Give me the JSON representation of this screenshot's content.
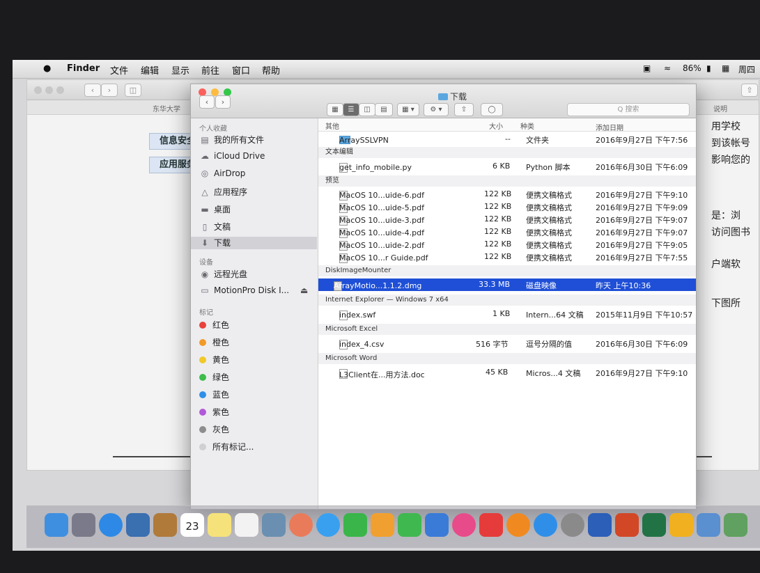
{
  "menubar": {
    "app": "Finder",
    "items": [
      "文件",
      "编辑",
      "显示",
      "前往",
      "窗口",
      "帮助"
    ],
    "battery": "86%",
    "clock": "周四"
  },
  "background_window": {
    "tab_label": "东华大学",
    "buttons": [
      "信息安全",
      "应用服务"
    ],
    "right_header": "说明",
    "right_texts": [
      "用学校",
      "到该帐号",
      "影响您的",
      "是：浏",
      "访问图书",
      "户端软",
      "下图所"
    ]
  },
  "finder": {
    "title": "下载",
    "search_placeholder": "Q 搜索",
    "sidebar": {
      "favorites_header": "个人收藏",
      "favorites": [
        {
          "icon": "all-files-icon",
          "label": "我的所有文件"
        },
        {
          "icon": "cloud-icon",
          "label": "iCloud Drive"
        },
        {
          "icon": "airdrop-icon",
          "label": "AirDrop"
        },
        {
          "icon": "applications-icon",
          "label": "应用程序"
        },
        {
          "icon": "desktop-icon",
          "label": "桌面"
        },
        {
          "icon": "documents-icon",
          "label": "文稿"
        },
        {
          "icon": "downloads-icon",
          "label": "下载"
        }
      ],
      "devices_header": "设备",
      "devices": [
        {
          "icon": "remote-disc-icon",
          "label": "远程光盘"
        },
        {
          "icon": "disk-icon",
          "label": "MotionPro Disk I...",
          "eject": "⏏"
        }
      ],
      "tags_header": "标记",
      "tags": [
        {
          "label": "红色",
          "color": "#e8423b"
        },
        {
          "label": "橙色",
          "color": "#f29a27"
        },
        {
          "label": "黄色",
          "color": "#f0c92a"
        },
        {
          "label": "绿色",
          "color": "#3dbd4b"
        },
        {
          "label": "蓝色",
          "color": "#2f8fe8"
        },
        {
          "label": "紫色",
          "color": "#b258d8"
        },
        {
          "label": "灰色",
          "color": "#8d8d8d"
        },
        {
          "label": "所有标记...",
          "color": "#d0d0d0"
        }
      ]
    },
    "columns": {
      "name": "其他",
      "size": "大小",
      "kind": "种类",
      "date": "添加日期"
    },
    "groups": [
      {
        "name": "",
        "rows": [
          {
            "icon": "folder",
            "name": "ArraySSLVPN",
            "size": "--",
            "kind": "文件夹",
            "date": "2016年9月27日 下午7:56"
          }
        ]
      },
      {
        "name": "文本编辑",
        "rows": [
          {
            "icon": "file",
            "name": "get_info_mobile.py",
            "size": "6 KB",
            "kind": "Python 脚本",
            "date": "2016年6月30日 下午6:09"
          }
        ]
      },
      {
        "name": "预览",
        "rows": [
          {
            "icon": "pdf",
            "name": "MacOS 10...uide-6.pdf",
            "size": "122 KB",
            "kind": "便携文稿格式",
            "date": "2016年9月27日 下午9:10"
          },
          {
            "icon": "pdf",
            "name": "MacOS 10...uide-5.pdf",
            "size": "122 KB",
            "kind": "便携文稿格式",
            "date": "2016年9月27日 下午9:09"
          },
          {
            "icon": "pdf",
            "name": "MacOS 10...uide-3.pdf",
            "size": "122 KB",
            "kind": "便携文稿格式",
            "date": "2016年9月27日 下午9:07"
          },
          {
            "icon": "pdf",
            "name": "MacOS 10...uide-4.pdf",
            "size": "122 KB",
            "kind": "便携文稿格式",
            "date": "2016年9月27日 下午9:07"
          },
          {
            "icon": "pdf",
            "name": "MacOS 10...uide-2.pdf",
            "size": "122 KB",
            "kind": "便携文稿格式",
            "date": "2016年9月27日 下午9:05"
          },
          {
            "icon": "pdf",
            "name": "MacOS 10...r Guide.pdf",
            "size": "122 KB",
            "kind": "便携文稿格式",
            "date": "2016年9月27日 下午7:55"
          }
        ]
      },
      {
        "name": "DiskImageMounter",
        "rows": [
          {
            "icon": "dmg",
            "name": "ArrayMotio...1.1.2.dmg",
            "size": "33.3 MB",
            "kind": "磁盘映像",
            "date": "昨天 上午10:36",
            "selected": true
          }
        ]
      },
      {
        "name": "Internet Explorer — Windows 7 x64",
        "rows": [
          {
            "icon": "file",
            "name": "index.swf",
            "size": "1 KB",
            "kind": "Intern...64 文稿",
            "date": "2015年11月9日 下午10:57"
          }
        ]
      },
      {
        "name": "Microsoft Excel",
        "rows": [
          {
            "icon": "file",
            "name": "index_4.csv",
            "size": "516 字节",
            "kind": "逗号分隔的值",
            "date": "2016年6月30日 下午6:09"
          }
        ]
      },
      {
        "name": "Microsoft Word",
        "rows": [
          {
            "icon": "file",
            "name": "L3Client在...用方法.doc",
            "size": "45 KB",
            "kind": "Micros...4 文稿",
            "date": "2016年9月27日 下午9:10"
          }
        ]
      }
    ]
  },
  "dock": {
    "calendar_day": "23",
    "icons": [
      {
        "name": "finder-icon",
        "color": "#3f8fe0"
      },
      {
        "name": "launchpad-icon",
        "color": "#7a7a8a"
      },
      {
        "name": "safari-icon",
        "color": "#2d89e5"
      },
      {
        "name": "preview-icon",
        "color": "#3a6fb0"
      },
      {
        "name": "contacts-icon",
        "color": "#b07a3a"
      },
      {
        "name": "calendar-icon",
        "color": "#ffffff"
      },
      {
        "name": "notes-icon",
        "color": "#f5e27a"
      },
      {
        "name": "reminders-icon",
        "color": "#f2f2f2"
      },
      {
        "name": "photo-booth-icon",
        "color": "#6a8fb0"
      },
      {
        "name": "photos-icon",
        "color": "#e97b5a"
      },
      {
        "name": "messages-icon",
        "color": "#39a0f0"
      },
      {
        "name": "facetime-icon",
        "color": "#3ab54a"
      },
      {
        "name": "pages-icon",
        "color": "#f0a030"
      },
      {
        "name": "numbers-icon",
        "color": "#3fb850"
      },
      {
        "name": "keynote-icon",
        "color": "#3b7bd8"
      },
      {
        "name": "itunes-icon",
        "color": "#e84b8a"
      },
      {
        "name": "app-red-icon",
        "color": "#e63b3b"
      },
      {
        "name": "ibooks-icon",
        "color": "#f08a20"
      },
      {
        "name": "app-store-icon",
        "color": "#2f8fe8"
      },
      {
        "name": "system-preferences-icon",
        "color": "#8a8a8a"
      },
      {
        "name": "word-icon",
        "color": "#2b5fb8"
      },
      {
        "name": "powerpoint-icon",
        "color": "#d24726"
      },
      {
        "name": "excel-icon",
        "color": "#217346"
      },
      {
        "name": "outlook-icon",
        "color": "#f0b020"
      },
      {
        "name": "app-icon-a",
        "color": "#5a8fd0"
      },
      {
        "name": "app-icon-b",
        "color": "#60a060"
      }
    ]
  }
}
